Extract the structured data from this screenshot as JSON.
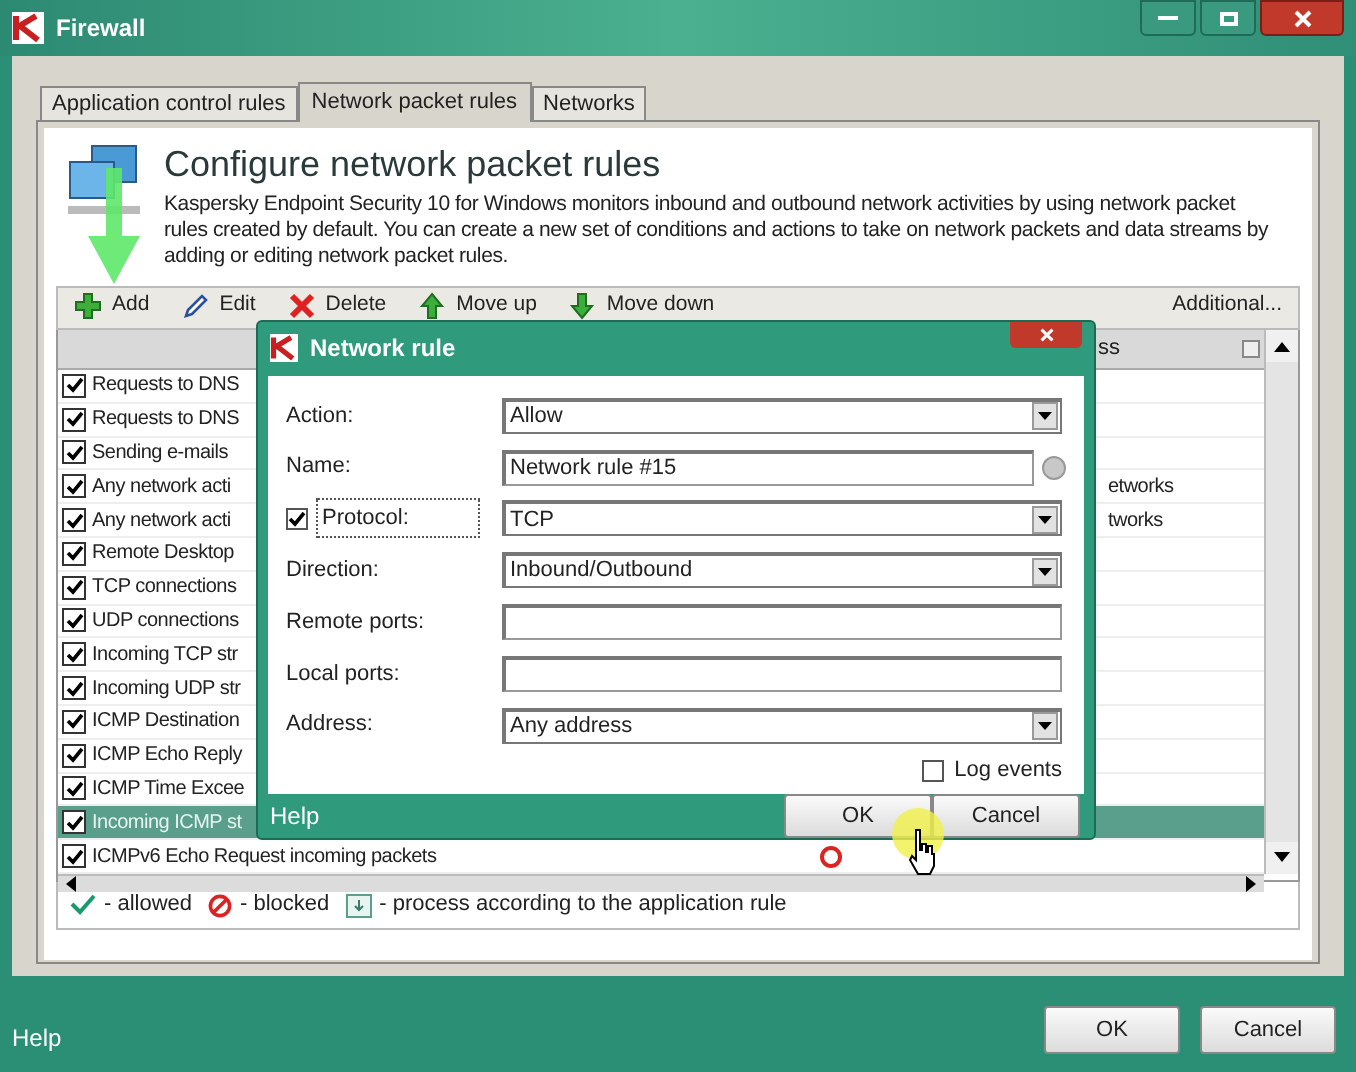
{
  "window": {
    "title": "Firewall"
  },
  "tabs": [
    {
      "label": "Application control rules",
      "selected": false
    },
    {
      "label": "Network packet rules",
      "selected": true
    },
    {
      "label": "Networks",
      "selected": false
    }
  ],
  "header": {
    "title": "Configure network packet rules",
    "description": "Kaspersky Endpoint Security 10 for Windows monitors inbound and outbound network activities by using network packet rules created by default. You can create a new set of conditions and actions to take on network packets and data streams by adding or editing network packet rules."
  },
  "toolbar": {
    "buttons": [
      {
        "kind": "add",
        "label": "Add"
      },
      {
        "kind": "edit",
        "label": "Edit"
      },
      {
        "kind": "delete",
        "label": "Delete"
      },
      {
        "kind": "move_up",
        "label": "Move up"
      },
      {
        "kind": "move_down",
        "label": "Move down"
      }
    ],
    "additional": "Additional..."
  },
  "table": {
    "column_header_fragment": "ss",
    "rows": [
      {
        "name": "Requests to DNS",
        "checked": true,
        "selected": false
      },
      {
        "name": "Requests to DNS",
        "checked": true,
        "selected": false
      },
      {
        "name": "Sending e-mails",
        "checked": true,
        "selected": false
      },
      {
        "name": "Any network acti",
        "checked": true,
        "selected": false,
        "column_2": "etworks"
      },
      {
        "name": "Any network acti",
        "checked": true,
        "selected": false,
        "column_2": "tworks"
      },
      {
        "name": "Remote Desktop",
        "checked": true,
        "selected": false
      },
      {
        "name": "TCP connections",
        "checked": true,
        "selected": false
      },
      {
        "name": "UDP connections",
        "checked": true,
        "selected": false
      },
      {
        "name": "Incoming TCP str",
        "checked": true,
        "selected": false
      },
      {
        "name": "Incoming UDP str",
        "checked": true,
        "selected": false
      },
      {
        "name": "ICMP Destination",
        "checked": true,
        "selected": false
      },
      {
        "name": "ICMP Echo Reply",
        "checked": true,
        "selected": false
      },
      {
        "name": "ICMP Time Excee",
        "checked": true,
        "selected": false
      },
      {
        "name": "Incoming ICMP st",
        "checked": true,
        "selected": true
      },
      {
        "name": "ICMPv6 Echo Request incoming packets",
        "checked": true,
        "selected": false,
        "blocked": true
      }
    ]
  },
  "legend": [
    {
      "kind": "allowed",
      "label": "- allowed"
    },
    {
      "kind": "blocked",
      "label": "- blocked"
    },
    {
      "kind": "app_rule",
      "label": "- process according to the application rule"
    }
  ],
  "dialog": {
    "title": "Network rule",
    "fields": [
      {
        "kind": "select",
        "label": "Action:",
        "value": "Allow"
      },
      {
        "kind": "text_info",
        "label": "Name:",
        "value": "Network rule #15"
      },
      {
        "kind": "select",
        "label": "Protocol:",
        "value": "TCP",
        "checked": true
      },
      {
        "kind": "select",
        "label": "Direction:",
        "value": "Inbound/Outbound"
      },
      {
        "kind": "text",
        "label": "Remote ports:"
      },
      {
        "kind": "text",
        "label": "Local ports:"
      },
      {
        "kind": "select",
        "label": "Address:",
        "value": "Any address"
      }
    ],
    "log_events": {
      "label": "Log events",
      "checked": false
    },
    "help": "Help",
    "buttons": [
      "OK",
      "Cancel"
    ]
  },
  "footer": {
    "help": "Help",
    "buttons": [
      "OK",
      "Cancel"
    ]
  }
}
